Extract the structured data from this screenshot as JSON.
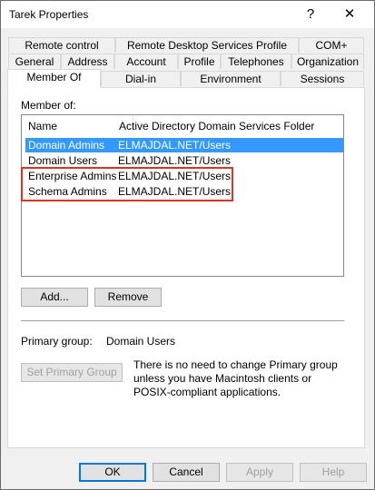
{
  "window": {
    "title": "Tarek Properties",
    "help_glyph": "?",
    "close_glyph": "✕"
  },
  "tabs": {
    "row1": [
      "Remote control",
      "Remote Desktop Services Profile",
      "COM+"
    ],
    "row2": [
      "General",
      "Address",
      "Account",
      "Profile",
      "Telephones",
      "Organization"
    ],
    "row3": [
      "Member Of",
      "Dial-in",
      "Environment",
      "Sessions"
    ],
    "selected": "Member Of"
  },
  "member_of": {
    "label": "Member of:",
    "columns": [
      "Name",
      "Active Directory Domain Services Folder"
    ],
    "rows": [
      {
        "name": "Domain Admins",
        "folder": "ELMAJDAL.NET/Users",
        "selected": true
      },
      {
        "name": "Domain Users",
        "folder": "ELMAJDAL.NET/Users",
        "selected": false
      },
      {
        "name": "Enterprise Admins",
        "folder": "ELMAJDAL.NET/Users",
        "selected": false
      },
      {
        "name": "Schema Admins",
        "folder": "ELMAJDAL.NET/Users",
        "selected": false
      }
    ],
    "highlight_color": "#e0301e",
    "add_label": "Add...",
    "remove_label": "Remove"
  },
  "primary_group": {
    "label": "Primary group:",
    "value": "Domain Users",
    "set_button": "Set Primary Group",
    "note": "There is no need to change Primary group unless you have Macintosh clients or POSIX-compliant applications."
  },
  "footer": {
    "ok": "OK",
    "cancel": "Cancel",
    "apply": "Apply",
    "help": "Help"
  },
  "colors": {
    "selection": "#3399ff",
    "accent": "#0078d7"
  }
}
